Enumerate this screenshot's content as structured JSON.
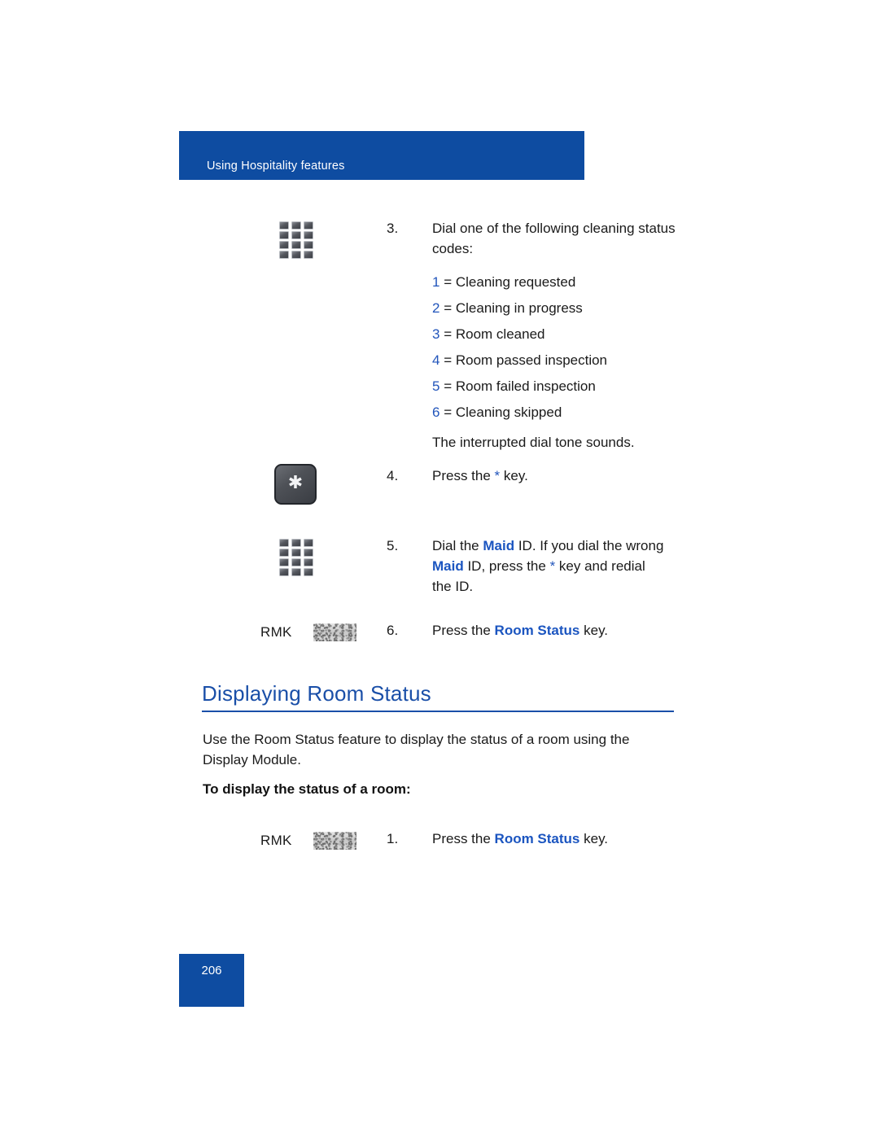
{
  "page": {
    "running_header": "Using Hospitality features",
    "page_number": "206",
    "accent_blue": "#0E4CA1",
    "heading_blue": "#1A4FA8",
    "emphasis_blue": "#1B55C0"
  },
  "steps_continued": {
    "step3": {
      "number": "3.",
      "text": "Dial one of the following cleaning status codes:",
      "icon": "dialpad-icon",
      "codes": [
        {
          "digit": "1",
          "equals": "= Cleaning requested"
        },
        {
          "digit": "2",
          "equals": "= Cleaning in progress"
        },
        {
          "digit": "3",
          "equals": "= Room cleaned"
        },
        {
          "digit": "4",
          "equals": "= Room passed inspection"
        },
        {
          "digit": "5",
          "equals": "= Room failed inspection"
        },
        {
          "digit": "6",
          "equals": "= Cleaning skipped"
        }
      ],
      "note": "The interrupted dial tone sounds."
    },
    "step4": {
      "number": "4.",
      "icon": "star-key-icon",
      "text_before": "Press the ",
      "emphasis": "*",
      "text_after": " key."
    },
    "step5": {
      "number": "5.",
      "icon": "dialpad-icon",
      "line1_before": "Dial the ",
      "line1_emphasis": "Maid",
      "line1_after": " ID. If you dial the wrong ",
      "line2_emphasis": "Maid",
      "line2_mid": " ID, press the ",
      "line2_star": "*",
      "line2_after": " key and redial the ID."
    },
    "step6": {
      "number": "6.",
      "key_label": "RMK",
      "key_icon": "feature-key-icon",
      "text_before": "Press the ",
      "emphasis": "Room Status",
      "text_after": " key."
    }
  },
  "section": {
    "heading": "Displaying Room Status",
    "paragraph": "Use the Room Status feature to display the status of a room using the Display Module.",
    "sub_heading": "To display the status of a room:",
    "step1": {
      "number": "1.",
      "key_label": "RMK",
      "key_icon": "feature-key-icon",
      "text_before": "Press the ",
      "emphasis": "Room Status",
      "text_after": " key."
    }
  }
}
